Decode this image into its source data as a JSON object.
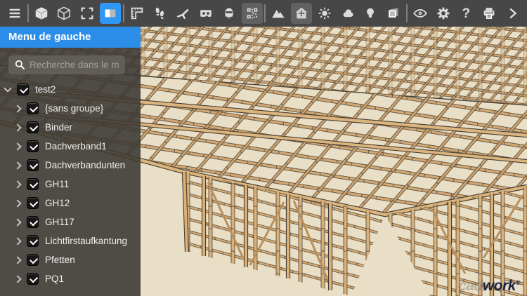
{
  "toolbar": {
    "background": "#474747",
    "icon_color": "#dcdcdc",
    "active_blue_color": "#2f96f3",
    "active_gray_color": "#616161",
    "help_label": "?",
    "icons": [
      "menu",
      "cube-solid",
      "cube-wireframe",
      "fit-to-screen",
      "left-panel-toggle",
      "ruler",
      "walk-footprints",
      "fly-plane",
      "vr-goggles",
      "avatar-head",
      "qr-code",
      "mountains",
      "house-move",
      "sun",
      "cloud",
      "light-bulb",
      "clip-frame",
      "eye",
      "gear",
      "help",
      "printer",
      "chevron-right"
    ],
    "active_states": {
      "blue": "left-panel-toggle",
      "gray": [
        "qr-code",
        "house-move"
      ]
    }
  },
  "sidebar": {
    "title": "Menu de gauche",
    "title_bar_color": "#2c8de8",
    "search": {
      "placeholder": "Recherche dans le menu de"
    },
    "tree": {
      "items": [
        {
          "label": "test2",
          "level": 0,
          "expanded": true,
          "checked": true
        },
        {
          "label": "{sans groupe}",
          "level": 1,
          "expanded": false,
          "checked": true
        },
        {
          "label": "Binder",
          "level": 1,
          "expanded": false,
          "checked": true
        },
        {
          "label": "Dachverband1",
          "level": 1,
          "expanded": false,
          "checked": true
        },
        {
          "label": "Dachverbandunten",
          "level": 1,
          "expanded": false,
          "checked": true
        },
        {
          "label": "GH11",
          "level": 1,
          "expanded": false,
          "checked": true
        },
        {
          "label": "GH12",
          "level": 1,
          "expanded": false,
          "checked": true
        },
        {
          "label": "GH117",
          "level": 1,
          "expanded": false,
          "checked": true
        },
        {
          "label": "Lichtfirstaufkantung",
          "level": 1,
          "expanded": false,
          "checked": true
        },
        {
          "label": "Pfetten",
          "level": 1,
          "expanded": false,
          "checked": true
        },
        {
          "label": "PQ1",
          "level": 1,
          "expanded": false,
          "checked": true
        }
      ]
    }
  },
  "viewport": {
    "background_color": "#e9dfc6",
    "wood_color": "#d2a873",
    "outline_color": "#4b4136"
  },
  "watermark": {
    "prefix": "cad",
    "suffix": "work",
    "reg": "®"
  }
}
